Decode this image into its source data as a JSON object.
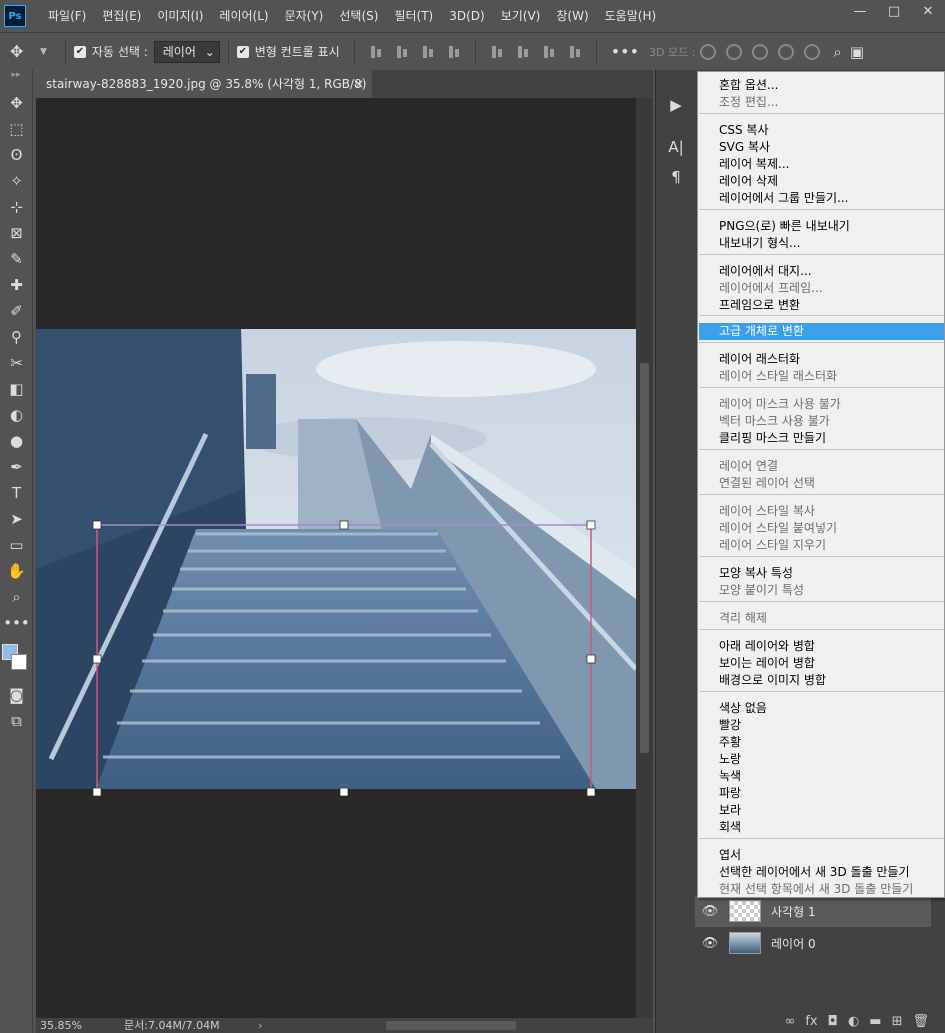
{
  "app": {
    "logo": "Ps"
  },
  "menubar": [
    "파일(F)",
    "편집(E)",
    "이미지(I)",
    "레이어(L)",
    "문자(Y)",
    "선택(S)",
    "필터(T)",
    "3D(D)",
    "보기(V)",
    "창(W)",
    "도움말(H)"
  ],
  "window_buttons": {
    "minimize": "—",
    "maximize": "□",
    "close": "✕"
  },
  "options": {
    "auto_select_label": "자동 선택 :",
    "auto_select_value": "레이어",
    "transform_label": "변형 컨트롤 표시",
    "more": "•••",
    "mode3d": "3D 모드 :"
  },
  "document": {
    "tab_title": "stairway-828883_1920.jpg @ 35.8% (사각형 1, RGB/8) *",
    "tab_close": "×"
  },
  "status": {
    "zoom": "35.85%",
    "doc": "문서:7.04M/7.04M",
    "arrow": "›"
  },
  "toolbar": {
    "header": "▸▸",
    "tools": [
      "✥",
      "⬚",
      "ʘ",
      "✧",
      "⊹",
      "⊠",
      "✎",
      "✚",
      "✐",
      "⚲",
      "✂",
      "◧",
      "◐",
      "●",
      "✒",
      "T",
      "➤",
      "▭",
      "✋",
      "⌕",
      "•••"
    ],
    "colors": {
      "foreground": "#8fbce6",
      "background": "#ffffff"
    }
  },
  "midstrip": [
    "▶",
    "A|",
    "¶"
  ],
  "layers": [
    {
      "name": "사각형",
      "suffix": "1",
      "eye": "👁"
    },
    {
      "name": "레이어",
      "suffix": "0",
      "eye": "👁"
    }
  ],
  "footer_icons": [
    "∞",
    "fx",
    "◘",
    "◐",
    "▬",
    "⊞",
    "🗑"
  ],
  "context_menu": [
    {
      "label": "혼합 옵션...",
      "disabled": false
    },
    {
      "label": "조정 편집...",
      "disabled": true
    },
    {
      "label": "CSS 복사",
      "disabled": false
    },
    {
      "label": "SVG 복사",
      "disabled": false
    },
    {
      "label": "레이어 복제...",
      "disabled": false
    },
    {
      "label": "레이어 삭제",
      "disabled": false
    },
    {
      "label": "레이어에서 그룹 만들기...",
      "disabled": false
    },
    {
      "label": "PNG으(로) 빠른 내보내기",
      "disabled": false
    },
    {
      "label": "내보내기 형식...",
      "disabled": false
    },
    {
      "label": "레이어에서 대지...",
      "disabled": false
    },
    {
      "label": "레이어에서 프레임...",
      "disabled": true
    },
    {
      "label": "프레임으로 변환",
      "disabled": false
    },
    {
      "label": "고급 개체로 변환",
      "disabled": false,
      "highlighted": true
    },
    {
      "label": "레이어 래스터화",
      "disabled": false
    },
    {
      "label": "레이어 스타일 래스터화",
      "disabled": true
    },
    {
      "label": "레이어 마스크 사용 불가",
      "disabled": true
    },
    {
      "label": "벡터 마스크 사용 불가",
      "disabled": true
    },
    {
      "label": "클리핑 마스크 만들기",
      "disabled": false
    },
    {
      "label": "레이어 연결",
      "disabled": true
    },
    {
      "label": "연결된 레이어 선택",
      "disabled": true
    },
    {
      "label": "레이어 스타일 복사",
      "disabled": true
    },
    {
      "label": "레이어 스타일 붙여넣기",
      "disabled": true
    },
    {
      "label": "레이어 스타일 지우기",
      "disabled": true
    },
    {
      "label": "모양 복사 특성",
      "disabled": false
    },
    {
      "label": "모양 붙이기 특성",
      "disabled": true
    },
    {
      "label": "격리 해제",
      "disabled": true
    },
    {
      "label": "아래 레이어와 병합",
      "disabled": false
    },
    {
      "label": "보이는 레이어 병합",
      "disabled": false
    },
    {
      "label": "배경으로 이미지 병합",
      "disabled": false
    },
    {
      "label": "색상 없음",
      "disabled": false
    },
    {
      "label": "빨강",
      "disabled": false
    },
    {
      "label": "주황",
      "disabled": false
    },
    {
      "label": "노랑",
      "disabled": false
    },
    {
      "label": "녹색",
      "disabled": false
    },
    {
      "label": "파랑",
      "disabled": false
    },
    {
      "label": "보라",
      "disabled": false
    },
    {
      "label": "회색",
      "disabled": false
    },
    {
      "label": "엽서",
      "disabled": false
    },
    {
      "label": "선택한 레이어에서 새 3D 돌출 만들기",
      "disabled": false
    },
    {
      "label": "현재 선택 항목에서 새 3D 돌출 만들기",
      "disabled": true
    }
  ],
  "colors": {
    "selection_stroke": "#d4577a",
    "menu_highlight": "#3d9ee9"
  }
}
